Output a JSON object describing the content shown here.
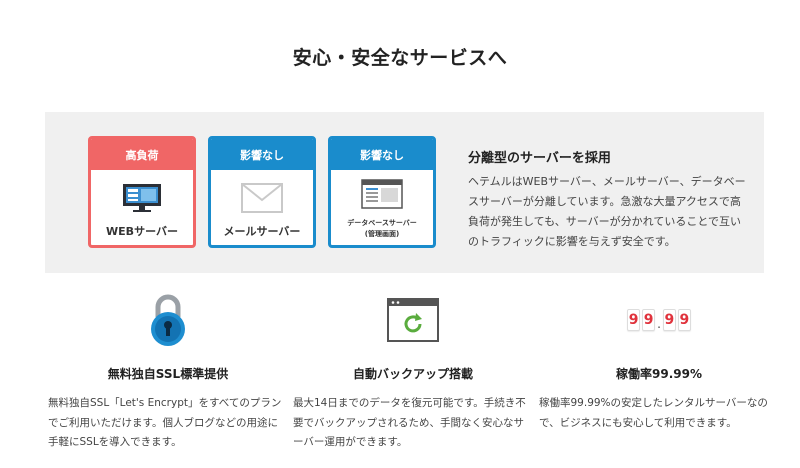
{
  "section": {
    "title": "安心・安全なサービスへ"
  },
  "servers": [
    {
      "badge": "高負荷",
      "label": "WEBサーバー",
      "icon": "monitor-icon",
      "status_color": "#f06666"
    },
    {
      "badge": "影響なし",
      "label": "メールサーバー",
      "icon": "mail-icon",
      "status_color": "#1a8ccc"
    },
    {
      "badge": "影響なし",
      "label_line1": "データベースサーバー",
      "label_line2": "(管理画面)",
      "icon": "browser-window-icon",
      "status_color": "#1a8ccc"
    }
  ],
  "separation": {
    "title": "分離型のサーバーを採用",
    "description": "ヘテムルはWEBサーバー、メールサーバー、データベースサーバーが分離しています。急激な大量アクセスで高負荷が発生しても、サーバーが分かれていることで互いのトラフィックに影響を与えず安全です。"
  },
  "features": [
    {
      "icon": "padlock-icon",
      "title": "無料独自SSL標準提供",
      "text": "無料独自SSL「Let's Encrypt」をすべてのプランでご利用いただけます。個人ブログなどの用途に手軽にSSLを導入できます。"
    },
    {
      "icon": "backup-refresh-icon",
      "title": "自動バックアップ搭載",
      "text": "最大14日までのデータを復元可能です。手続き不要でバックアップされるため、手間なく安心なサーバー運用ができます。"
    },
    {
      "icon": "uptime-counter-icon",
      "title": "稼働率99.99%",
      "digits": [
        "9",
        "9",
        "9",
        "9"
      ],
      "digit_dot": ".",
      "text": "稼働率99.99%の安定したレンタルサーバーなので、ビジネスにも安心して利用できます。"
    }
  ],
  "colors": {
    "high_load": "#f06666",
    "no_impact": "#1a8ccc",
    "panel_bg": "#f0f0f0",
    "digit_red": "#e0323c"
  }
}
